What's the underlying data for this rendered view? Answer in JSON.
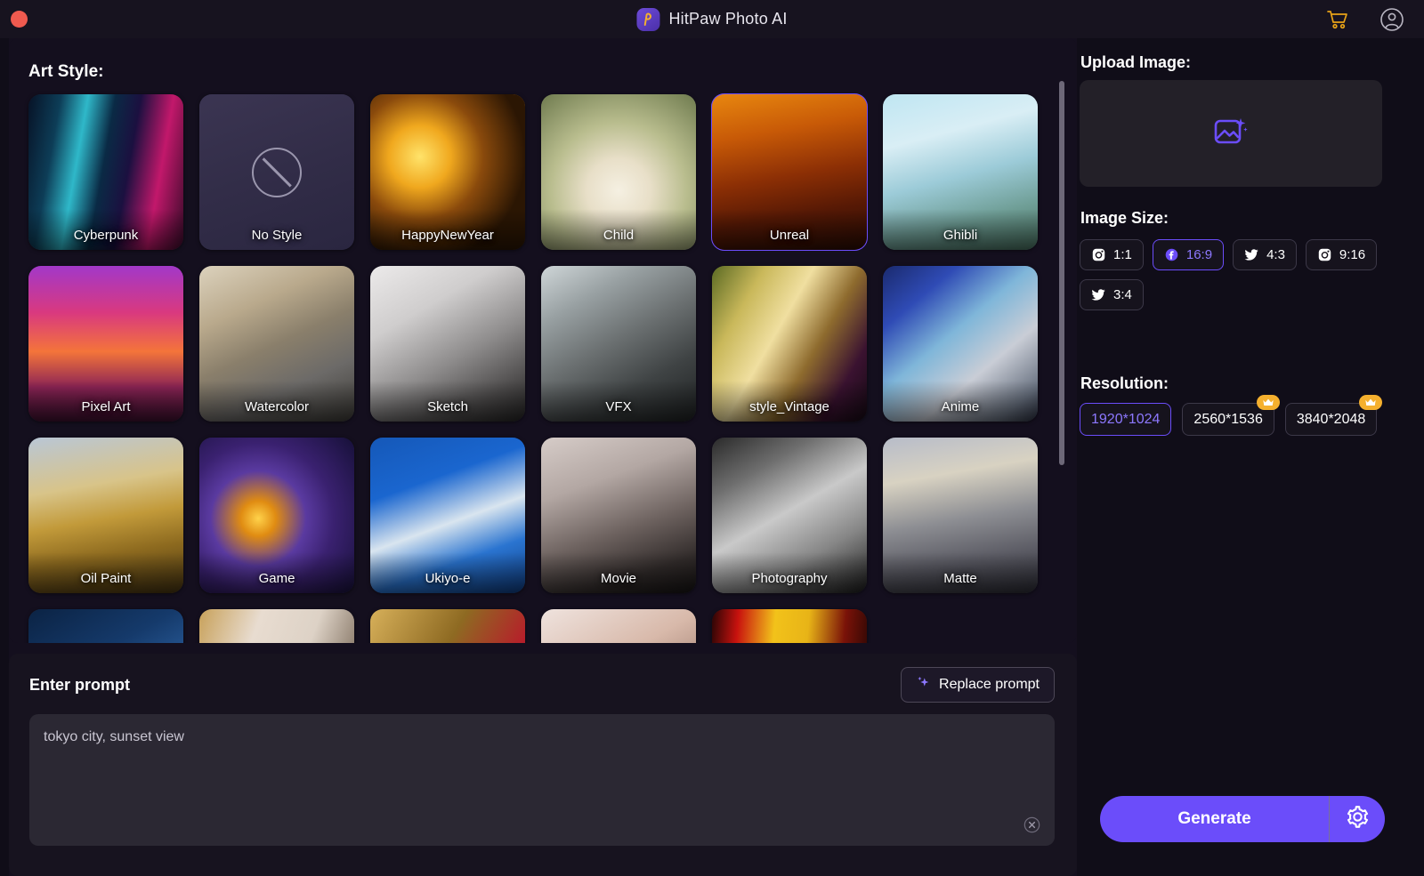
{
  "window": {
    "close_label": "",
    "title": "HitPaw Photo AI",
    "cart_icon": "cart-icon",
    "account_icon": "account-icon"
  },
  "art_style": {
    "heading": "Art Style:",
    "selected": "Unreal",
    "items": [
      {
        "label": "Cyberpunk",
        "kind": "image",
        "selected": false
      },
      {
        "label": "No Style",
        "kind": "nostyle",
        "selected": false
      },
      {
        "label": "HappyNewYear",
        "kind": "image",
        "selected": false
      },
      {
        "label": "Child",
        "kind": "image",
        "selected": false
      },
      {
        "label": "Unreal",
        "kind": "image",
        "selected": true
      },
      {
        "label": "Ghibli",
        "kind": "image",
        "selected": false
      },
      {
        "label": "Pixel Art",
        "kind": "image",
        "selected": false
      },
      {
        "label": "Watercolor",
        "kind": "image",
        "selected": false
      },
      {
        "label": "Sketch",
        "kind": "image",
        "selected": false
      },
      {
        "label": "VFX",
        "kind": "image",
        "selected": false
      },
      {
        "label": "style_Vintage",
        "kind": "image",
        "selected": false
      },
      {
        "label": "Anime",
        "kind": "image",
        "selected": false
      },
      {
        "label": "Oil Paint",
        "kind": "image",
        "selected": false
      },
      {
        "label": "Game",
        "kind": "image",
        "selected": false
      },
      {
        "label": "Ukiyo-e",
        "kind": "image",
        "selected": false
      },
      {
        "label": "Movie",
        "kind": "image",
        "selected": false
      },
      {
        "label": "Photography",
        "kind": "image",
        "selected": false
      },
      {
        "label": "Matte",
        "kind": "image",
        "selected": false
      },
      {
        "label": "",
        "kind": "image",
        "selected": false
      },
      {
        "label": "",
        "kind": "image",
        "selected": false
      },
      {
        "label": "",
        "kind": "image",
        "selected": false
      },
      {
        "label": "",
        "kind": "image",
        "selected": false
      },
      {
        "label": "",
        "kind": "image",
        "selected": false
      }
    ]
  },
  "prompt": {
    "heading": "Enter prompt",
    "replace_label": "Replace prompt",
    "value": "tokyo city, sunset view",
    "placeholder": "Enter prompt",
    "clear_icon": "clear-icon"
  },
  "upload": {
    "label": "Upload Image:",
    "icon": "image-sparkle-icon"
  },
  "image_size": {
    "label": "Image Size:",
    "selected": "16:9",
    "options": [
      {
        "label": "1:1",
        "icon": "instagram-icon",
        "active": false
      },
      {
        "label": "16:9",
        "icon": "facebook-icon",
        "active": true
      },
      {
        "label": "4:3",
        "icon": "twitter-icon",
        "active": false
      },
      {
        "label": "9:16",
        "icon": "instagram-icon",
        "active": false
      },
      {
        "label": "3:4",
        "icon": "twitter-icon",
        "active": false
      }
    ]
  },
  "resolution": {
    "label": "Resolution:",
    "selected": "1920*1024",
    "options": [
      {
        "label": "1920*1024",
        "active": true,
        "premium": false
      },
      {
        "label": "2560*1536",
        "active": false,
        "premium": true
      },
      {
        "label": "3840*2048",
        "active": false,
        "premium": true
      }
    ]
  },
  "actions": {
    "generate_label": "Generate",
    "settings_icon": "gear-icon"
  },
  "colors": {
    "accent": "#6b4dfa",
    "accent_text": "#8d78ff",
    "premium": "#f5b02e",
    "cart": "#e8a317",
    "close": "#f05a4f",
    "bg": "#100d18",
    "panel": "#140f1e",
    "prompt_panel": "#17131f",
    "textarea": "#2b2833"
  }
}
